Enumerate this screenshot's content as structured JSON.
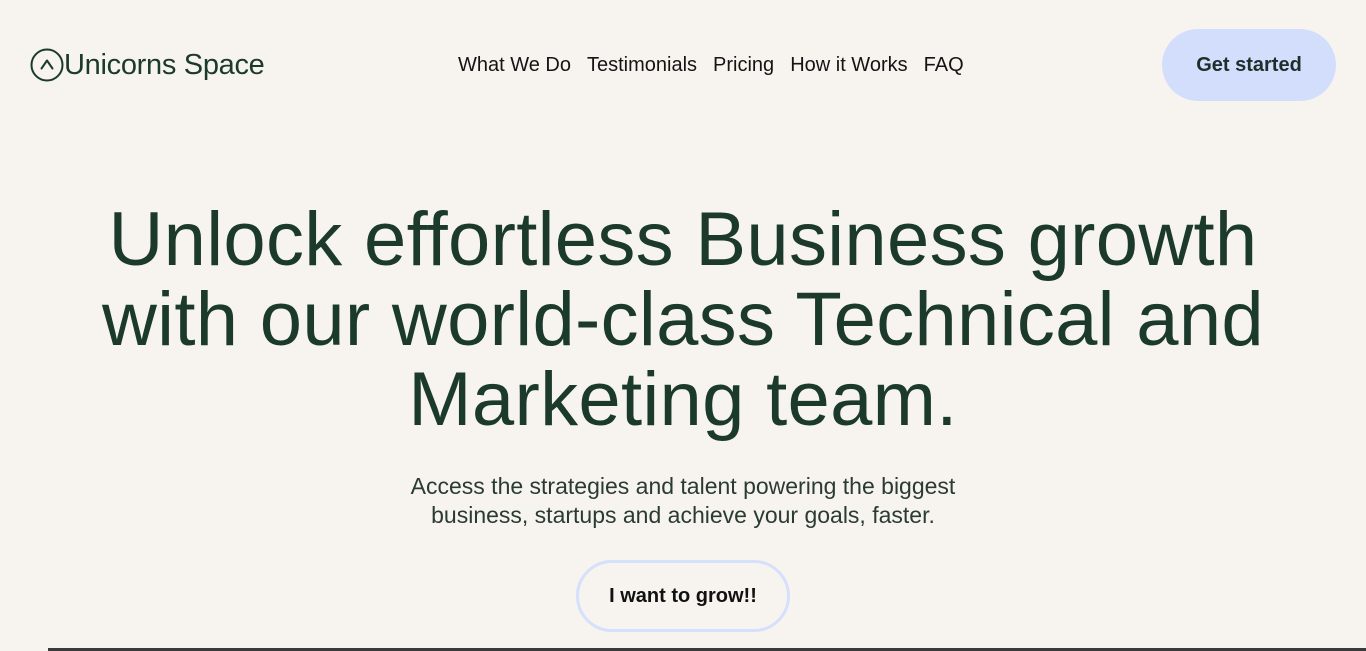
{
  "brand": {
    "name": "Unicorns Space",
    "icon": "chevron-up-circle-icon"
  },
  "nav": {
    "items": [
      {
        "label": "What We Do"
      },
      {
        "label": "Testimonials"
      },
      {
        "label": "Pricing"
      },
      {
        "label": "How it Works"
      },
      {
        "label": "FAQ"
      }
    ],
    "cta_label": "Get started"
  },
  "hero": {
    "title_lines": [
      "Unlock effortless Business growth",
      "with our world-class Technical and",
      "Marketing team."
    ],
    "subtitle_lines": [
      "Access the strategies and talent powering the biggest",
      "business, startups and achieve your goals, faster."
    ],
    "cta_label": "I want to grow!!"
  },
  "colors": {
    "background": "#f7f4ef",
    "text_primary": "#1c3a2c",
    "cta_fill": "#d3defd",
    "cta_border": "#d6e0fd"
  }
}
